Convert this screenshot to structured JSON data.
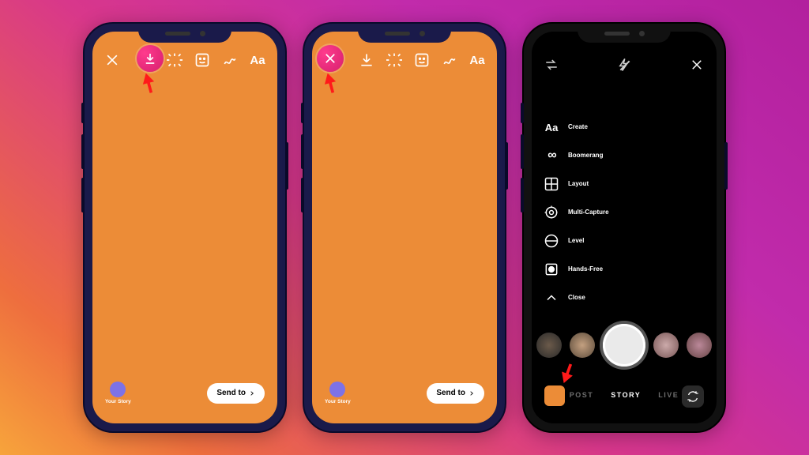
{
  "screen_edit": {
    "toolbar": {
      "close": "close",
      "download": "download",
      "sparkle": "effects",
      "sticker": "sticker",
      "draw": "draw",
      "text_label": "Aa"
    },
    "your_story_label": "Your Story",
    "send_to_label": "Send to"
  },
  "screen_camera": {
    "tools": [
      {
        "key": "create",
        "label": "Create"
      },
      {
        "key": "boomerang",
        "label": "Boomerang"
      },
      {
        "key": "layout",
        "label": "Layout"
      },
      {
        "key": "multi",
        "label": "Multi-Capture"
      },
      {
        "key": "level",
        "label": "Level"
      },
      {
        "key": "hands",
        "label": "Hands-Free"
      },
      {
        "key": "close",
        "label": "Close"
      }
    ],
    "modes": {
      "post": "POST",
      "story": "STORY",
      "live": "LIVE"
    }
  },
  "colors": {
    "canvas": "#ec8c37",
    "highlight": "#e6247a",
    "arrow": "#ff1a1a"
  }
}
